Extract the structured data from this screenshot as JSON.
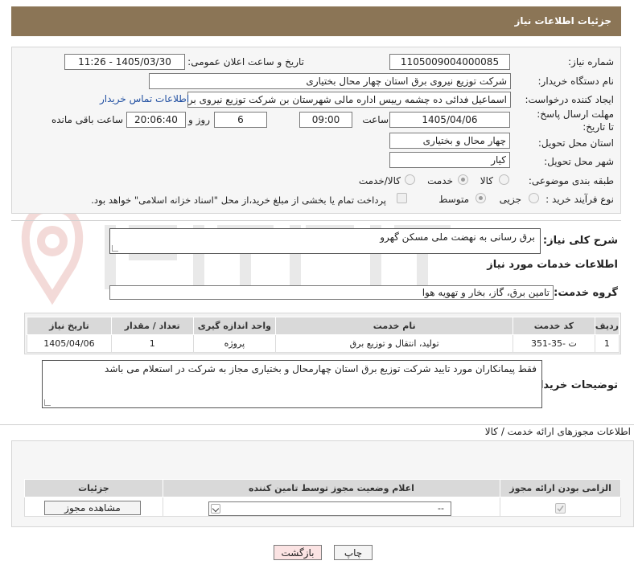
{
  "header": {
    "title": "جزئیات اطلاعات نیاز"
  },
  "form": {
    "need_number_label": "شماره نیاز:",
    "need_number": "1105009004000085",
    "announce_label": "تاریخ و ساعت اعلان عمومی:",
    "announce_value": "1405/03/30 - 11:26",
    "buyer_org_label": "نام دستگاه خریدار:",
    "buyer_org": "شرکت توزیع نیروی برق استان چهار محال بختیاری",
    "requester_label": "ایجاد کننده درخواست:",
    "requester": "اسماعیل فدائی ده چشمه رییس اداره مالی شهرستان بن  شرکت توزیع نیروی برق",
    "contact_link": "اطلاعات تماس خریدار",
    "deadline_label": "مهلت ارسال پاسخ: تا تاریخ:",
    "deadline_date": "1405/04/06",
    "time_label": "ساعت",
    "deadline_time": "09:00",
    "days_value": "6",
    "days_label": "روز و",
    "remaining_time": "20:06:40",
    "remaining_label": "ساعت باقی مانده",
    "province_label": "استان محل تحویل:",
    "province": "چهار محال و بختیاری",
    "city_label": "شهر محل تحویل:",
    "city": "کیار",
    "category_label": "طبقه بندی موضوعی:",
    "category_options": [
      "کالا",
      "خدمت",
      "کالا/خدمت"
    ],
    "process_label": "نوع فرآیند خرید :",
    "process_options": [
      "جزیی",
      "متوسط"
    ],
    "payment_note": "پرداخت تمام یا بخشی از مبلغ خرید،از محل \"اسناد خزانه اسلامی\" خواهد بود."
  },
  "description": {
    "general_label": "شرح کلی نیاز:",
    "general_text": "برق رسانی به نهضت ملی مسکن گهرو",
    "services_title": "اطلاعات خدمات مورد نیاز",
    "service_group_label": "گروه خدمت:",
    "service_group": "تامین برق، گاز، بخار و تهویه هوا",
    "table": {
      "headers": [
        "ردیف",
        "کد خدمت",
        "نام خدمت",
        "واحد اندازه گیری",
        "تعداد / مقدار",
        "تاریخ نیاز"
      ],
      "rows": [
        [
          "1",
          "ت -35-351",
          "تولید، انتقال و توزیع برق",
          "پروژه",
          "1",
          "1405/04/06"
        ]
      ]
    },
    "buyer_notes_label": "توضیحات خریدار:",
    "buyer_notes": "فقط پیمانکاران مورد تایید شرکت توزیع برق استان چهارمحال و بختیاری مجاز به شرکت در استعلام می باشد"
  },
  "permits": {
    "section_title": "اطلاعات مجوزهای ارائه خدمت / کالا",
    "headers": [
      "الزامی بودن ارائه مجوز",
      "اعلام وضعیت مجوز توسط تامین کننده",
      "جزئیات"
    ],
    "select_value": "--",
    "view_button": "مشاهده مجوز"
  },
  "actions": {
    "print": "چاپ",
    "back": "بازگشت"
  }
}
